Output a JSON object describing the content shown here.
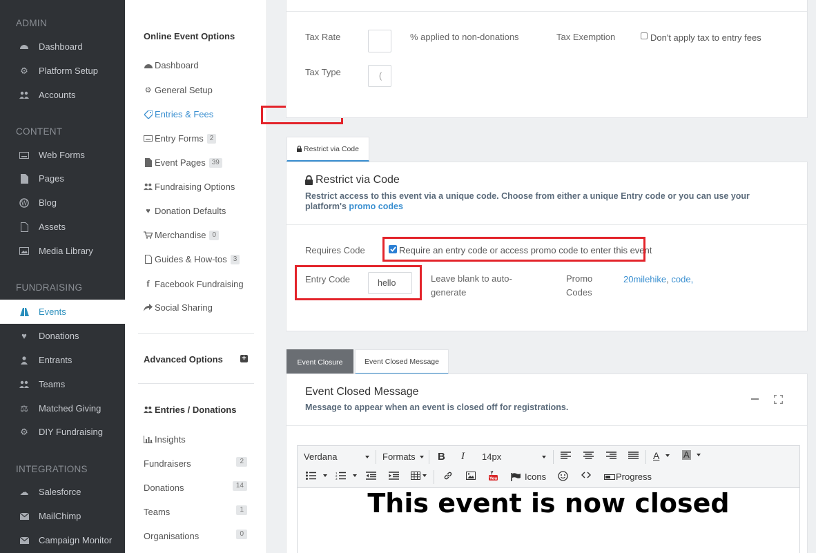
{
  "sidebar": {
    "sections": {
      "admin": "ADMIN",
      "content": "CONTENT",
      "fundraising": "FUNDRAISING",
      "integrations": "INTEGRATIONS"
    },
    "admin_items": [
      "Dashboard",
      "Platform Setup",
      "Accounts"
    ],
    "content_items": [
      "Web Forms",
      "Pages",
      "Blog",
      "Assets",
      "Media Library"
    ],
    "fundraising_items": [
      "Events",
      "Donations",
      "Entrants",
      "Teams",
      "Matched Giving",
      "DIY Fundraising"
    ],
    "integration_items": [
      "Salesforce",
      "MailChimp",
      "Campaign Monitor"
    ],
    "active_item": "Events"
  },
  "subnav": {
    "title": "Online Event Options",
    "items": [
      {
        "label": "Dashboard",
        "icon": "dashboard-icon"
      },
      {
        "label": "General Setup",
        "icon": "gear-icon"
      },
      {
        "label": "Entries & Fees",
        "icon": "tag-icon"
      },
      {
        "label": "Entry Forms",
        "icon": "keyboard-icon",
        "badge": "2"
      },
      {
        "label": "Event Pages",
        "icon": "file-icon",
        "badge": "39"
      },
      {
        "label": "Fundraising Options",
        "icon": "users-icon"
      },
      {
        "label": "Donation Defaults",
        "icon": "heart-icon"
      },
      {
        "label": "Merchandise",
        "icon": "cart-icon",
        "badge": "0"
      },
      {
        "label": "Guides & How-tos",
        "icon": "pdf-icon",
        "badge": "3"
      },
      {
        "label": "Facebook Fundraising",
        "icon": "facebook-icon"
      },
      {
        "label": "Social Sharing",
        "icon": "share-icon"
      }
    ],
    "advanced_title": "Advanced Options",
    "entries_title": "Entries / Donations",
    "entries_items": [
      {
        "label": "Insights"
      },
      {
        "label": "Fundraisers",
        "badge": "2"
      },
      {
        "label": "Donations",
        "badge": "14"
      },
      {
        "label": "Teams",
        "badge": "1"
      },
      {
        "label": "Organisations",
        "badge": "0"
      }
    ]
  },
  "tax": {
    "tax_rate_label": "Tax Rate",
    "tax_rate_value": "",
    "tax_rate_note": "% applied to non-donations",
    "tax_exemption_label": "Tax Exemption",
    "tax_exemption_checkbox": "Don't apply tax to entry fees",
    "tax_type_label": "Tax Type",
    "tax_type_value": "("
  },
  "restrict": {
    "tab_label": "Restrict via Code",
    "title": "Restrict via Code",
    "description": "Restrict access to this event via a unique code. Choose from either a unique Entry code or you can use your platform's",
    "description_link": "promo codes",
    "requires_code_label": "Requires Code",
    "requires_code_checkbox": "Require an entry code or access promo code to enter this event",
    "requires_code_checked": true,
    "entry_code_label": "Entry Code",
    "entry_code_value": "hello",
    "entry_code_hint": "Leave blank to auto-generate",
    "promo_codes_label": "Promo Codes",
    "promo_code_1": "20milehike",
    "promo_code_2": "code"
  },
  "closure": {
    "tab_closure": "Event Closure",
    "tab_message": "Event Closed Message",
    "title": "Event Closed Message",
    "subtitle": "Message to appear when an event is closed off for registrations.",
    "editor": {
      "font": "Verdana",
      "formats": "Formats",
      "size": "14px",
      "icons_label": "Icons",
      "progress_label": "Progress",
      "content": "This event is now closed"
    }
  }
}
